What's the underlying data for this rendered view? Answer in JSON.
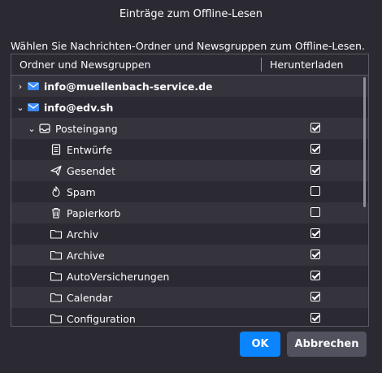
{
  "dialog": {
    "title": "Einträge zum Offline-Lesen",
    "instruction": "Wählen Sie Nachrichten-Ordner und Newsgruppen zum Offline-Lesen."
  },
  "tree": {
    "columns": {
      "name": "Ordner und Newsgruppen",
      "download": "Herunterladen"
    },
    "rows": [
      {
        "label": "info@muellenbach-service.de",
        "icon": "mail-account-icon",
        "twisty": "›",
        "bold": true,
        "checked": null
      },
      {
        "label": "info@edv.sh",
        "icon": "mail-account-icon",
        "twisty": "⌄",
        "bold": true,
        "checked": null
      },
      {
        "label": "Posteingang",
        "icon": "inbox-icon",
        "twisty": "⌄",
        "bold": false,
        "checked": true
      },
      {
        "label": "Entwürfe",
        "icon": "drafts-icon",
        "twisty": "",
        "bold": false,
        "checked": true
      },
      {
        "label": "Gesendet",
        "icon": "sent-icon",
        "twisty": "",
        "bold": false,
        "checked": true
      },
      {
        "label": "Spam",
        "icon": "spam-icon",
        "twisty": "",
        "bold": false,
        "checked": false
      },
      {
        "label": "Papierkorb",
        "icon": "trash-icon",
        "twisty": "",
        "bold": false,
        "checked": false
      },
      {
        "label": "Archiv",
        "icon": "folder-icon",
        "twisty": "",
        "bold": false,
        "checked": true
      },
      {
        "label": "Archive",
        "icon": "folder-icon",
        "twisty": "",
        "bold": false,
        "checked": true
      },
      {
        "label": "AutoVersicherungen",
        "icon": "folder-icon",
        "twisty": "",
        "bold": false,
        "checked": true
      },
      {
        "label": "Calendar",
        "icon": "folder-icon",
        "twisty": "",
        "bold": false,
        "checked": true
      },
      {
        "label": "Configuration",
        "icon": "folder-icon",
        "twisty": "",
        "bold": false,
        "checked": true
      }
    ]
  },
  "buttons": {
    "ok": "OK",
    "cancel": "Abbrechen"
  },
  "colors": {
    "background": "#2b2a33",
    "accent": "#0a84ff",
    "row_shade": "#35343c"
  }
}
